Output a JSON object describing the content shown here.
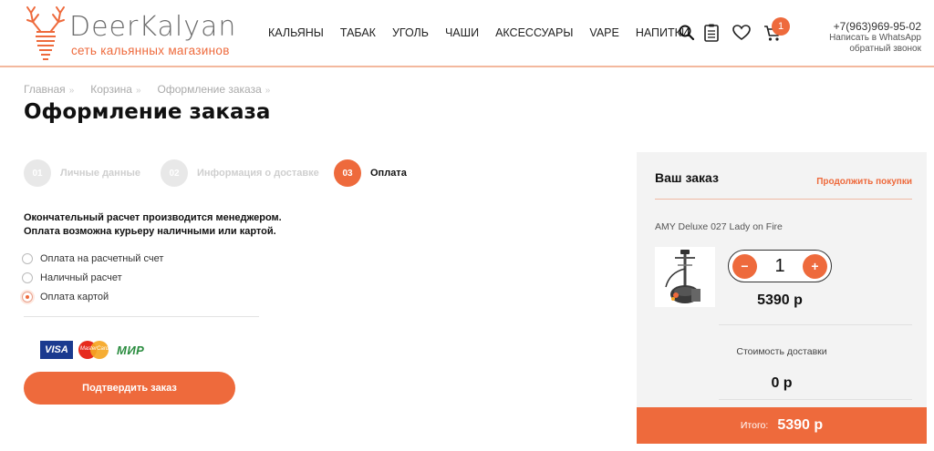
{
  "brand": {
    "name": "DeerKalyan",
    "tagline": "сеть кальянных магазинов",
    "accent_color": "#ee6a3c"
  },
  "nav": {
    "items": [
      "КАЛЬЯНЫ",
      "ТАБАК",
      "УГОЛЬ",
      "ЧАШИ",
      "АКСЕССУАРЫ",
      "VAPE",
      "НАПИТКИ"
    ]
  },
  "header_icons": {
    "search": "search-icon",
    "orders": "clipboard-icon",
    "favorites": "heart-icon",
    "cart": "cart-icon",
    "cart_count": "1"
  },
  "contacts": {
    "phone": "+7(963)969-95-02",
    "whatsapp": "Написать в WhatsApp",
    "callback": "обратный звонок"
  },
  "breadcrumb": [
    "Главная",
    "Корзина",
    "Оформление заказа"
  ],
  "page_title": "Оформление заказа",
  "steps": [
    {
      "number": "01",
      "label": "Личные данные",
      "active": false
    },
    {
      "number": "02",
      "label": "Информация о доставке",
      "active": false
    },
    {
      "number": "03",
      "label": "Оплата",
      "active": true
    }
  ],
  "payment": {
    "note_line1": "Окончательный расчет производится менеджером.",
    "note_line2": "Оплата возможна курьеру наличными или картой.",
    "options": [
      {
        "label": "Оплата на расчетный счет",
        "checked": false
      },
      {
        "label": "Наличный расчет",
        "checked": false
      },
      {
        "label": "Оплата картой",
        "checked": true
      }
    ],
    "logos": {
      "visa": "VISA",
      "mastercard": "MasterCard",
      "mir": "МИР"
    },
    "confirm_label": "Подтвердить заказ"
  },
  "order": {
    "title": "Ваш заказ",
    "continue_label": "Продолжить покупки",
    "product_name": "AMY Deluxe 027 Lady on Fire",
    "quantity": "1",
    "minus": "−",
    "plus": "+",
    "item_price": "5390 р",
    "delivery_label": "Стоимость доставки",
    "delivery_price": "0 р",
    "total_label": "Итого:",
    "total_value": "5390 р"
  }
}
